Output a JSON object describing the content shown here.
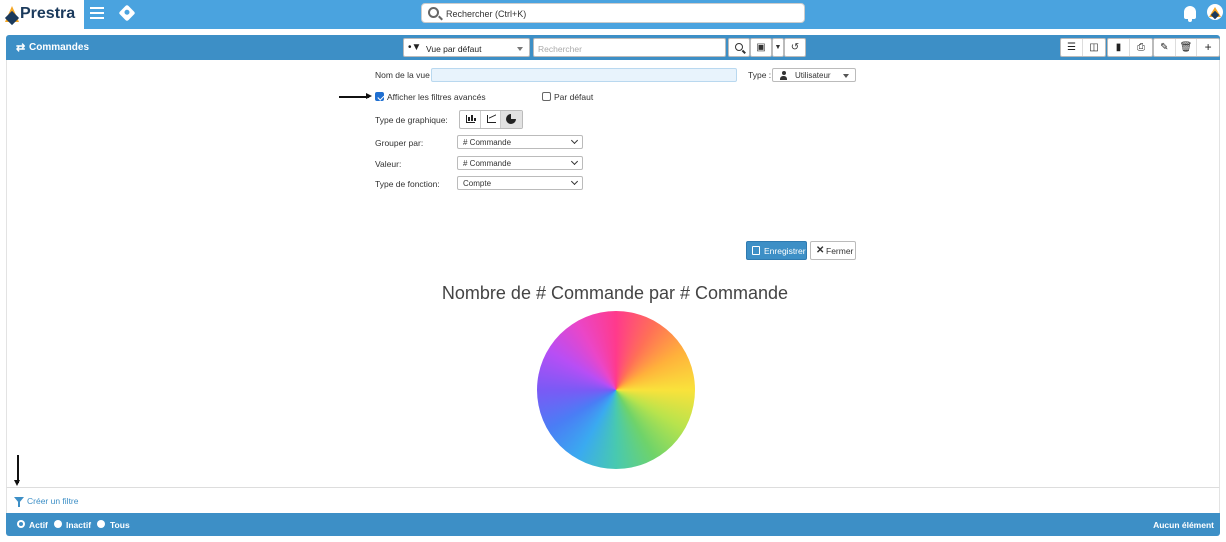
{
  "app": {
    "brand": "Prestra"
  },
  "topbar": {
    "search_text": "Rechercher (Ctrl+K)"
  },
  "header": {
    "title": "Commandes",
    "view_select": "Vue par défaut",
    "search_placeholder": "Rechercher"
  },
  "form": {
    "view_name_label": "Nom de la vue :",
    "view_name_value": "",
    "type_label": "Type :",
    "type_value": "Utilisateur",
    "advanced_filters_label": "Afficher les filtres avancés",
    "advanced_filters_checked": true,
    "default_label": "Par défaut",
    "default_checked": false,
    "chart_type_label": "Type de graphique:",
    "chart_type_selected": "pie",
    "group_by_label": "Grouper par:",
    "group_by_value": "# Commande",
    "value_label": "Valeur:",
    "value_value": "# Commande",
    "function_label": "Type de fonction:",
    "function_value": "Compte"
  },
  "actions": {
    "save": "Enregistrer",
    "close": "Fermer"
  },
  "chart_data": {
    "type": "pie",
    "title": "Nombre de # Commande par # Commande"
  },
  "filter": {
    "create_label": "Créer un filtre"
  },
  "footer": {
    "status_options": [
      "Actif",
      "Inactif",
      "Tous"
    ],
    "selected": "Actif",
    "count_text": "Aucun élément"
  },
  "colors": {
    "primary": "#3d8fc6",
    "topbar": "#4aa3df",
    "logo_orange": "#f5a623",
    "logo_navy": "#1b3a5c"
  }
}
